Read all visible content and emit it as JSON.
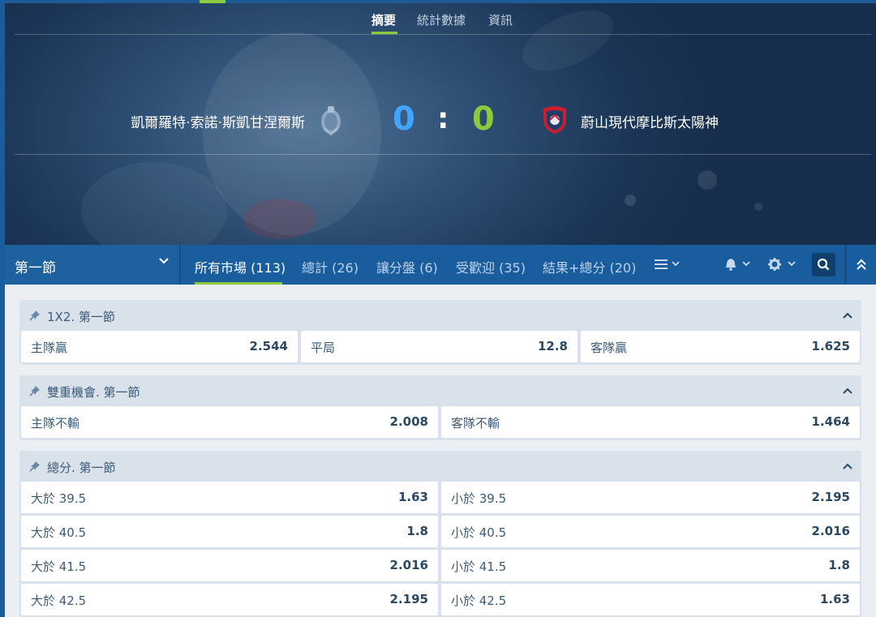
{
  "hero": {
    "tabs": [
      "摘要",
      "統計數據",
      "資訊"
    ],
    "home_team": "凱爾羅特·索諾·斯凱甘涅爾斯",
    "away_team": "蔚山現代摩比斯太陽神",
    "home_score": "0",
    "away_score": "0",
    "score_separator": ":"
  },
  "market_bar": {
    "period": "第一節",
    "tabs": [
      "所有市場 (113)",
      "總計 (26)",
      "讓分盤 (6)",
      "受歡迎 (35)",
      "結果+總分 (20)"
    ],
    "active_tab_index": 0
  },
  "markets": [
    {
      "title": "1X2. 第一節",
      "rows": [
        [
          {
            "label": "主隊贏",
            "odds": "2.544"
          },
          {
            "label": "平局",
            "odds": "12.8"
          },
          {
            "label": "客隊贏",
            "odds": "1.625"
          }
        ]
      ]
    },
    {
      "title": "雙重機會. 第一節",
      "rows": [
        [
          {
            "label": "主隊不輸",
            "odds": "2.008"
          },
          {
            "label": "客隊不輸",
            "odds": "1.464"
          }
        ]
      ]
    },
    {
      "title": "總分. 第一節",
      "rows": [
        [
          {
            "label": "大於 39.5",
            "odds": "1.63"
          },
          {
            "label": "小於 39.5",
            "odds": "2.195"
          }
        ],
        [
          {
            "label": "大於 40.5",
            "odds": "1.8"
          },
          {
            "label": "小於 40.5",
            "odds": "2.016"
          }
        ],
        [
          {
            "label": "大於 41.5",
            "odds": "2.016"
          },
          {
            "label": "小於 41.5",
            "odds": "1.8"
          }
        ],
        [
          {
            "label": "大於 42.5",
            "odds": "2.195"
          },
          {
            "label": "小於 42.5",
            "odds": "1.63"
          }
        ]
      ]
    }
  ],
  "colors": {
    "accent_green": "#8ecb3c",
    "home_score_blue": "#41a6ff",
    "bar_blue": "#1a5d9e"
  }
}
